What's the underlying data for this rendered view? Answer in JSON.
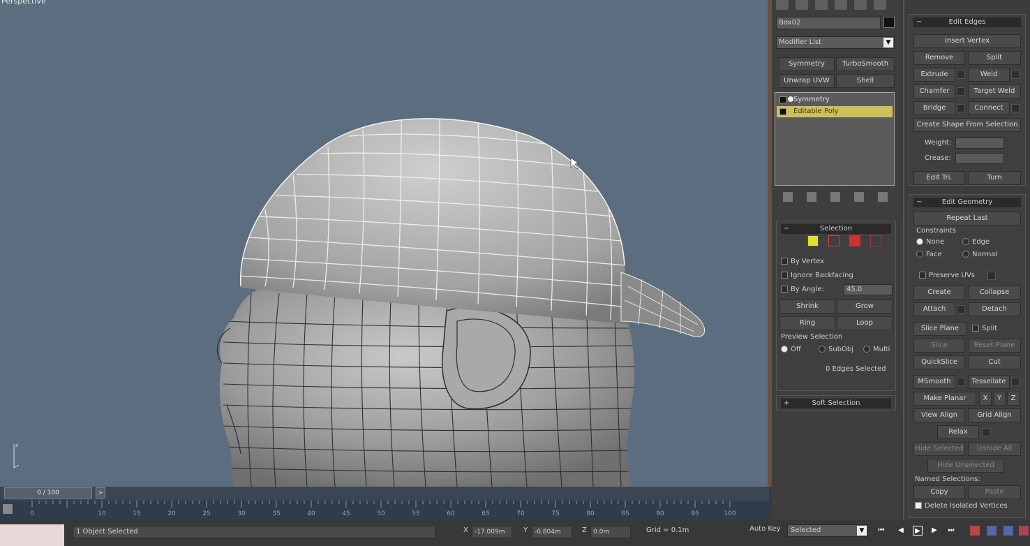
{
  "viewport": {
    "label": "Perspective"
  },
  "panel": {
    "object_name": "Box02",
    "modifier_list": "Modifier List",
    "quick_buttons": [
      "Symmetry",
      "TurboSmooth",
      "Unwrap UVW",
      "Shell"
    ],
    "stack": [
      {
        "name": "Symmetry",
        "selected": false
      },
      {
        "name": "Editable Poly",
        "selected": true
      }
    ],
    "selection": {
      "title": "Selection",
      "by_vertex": "By Vertex",
      "ignore_backfacing": "Ignore Backfacing",
      "by_angle": "By Angle:",
      "angle_value": "45.0",
      "shrink": "Shrink",
      "grow": "Grow",
      "ring": "Ring",
      "loop": "Loop",
      "preview_label": "Preview Selection",
      "preview_options": [
        "Off",
        "SubObj",
        "Multi"
      ],
      "status": "0 Edges Selected"
    },
    "soft_selection": {
      "title": "Soft Selection"
    },
    "edit_edges": {
      "title": "Edit Edges",
      "insert_vertex": "Insert Vertex",
      "remove": "Remove",
      "split": "Split",
      "extrude": "Extrude",
      "weld": "Weld",
      "chamfer": "Chamfer",
      "target_weld": "Target Weld",
      "bridge": "Bridge",
      "connect": "Connect",
      "create_shape": "Create Shape From Selection",
      "weight": "Weight:",
      "crease": "Crease:",
      "edit_tri": "Edit Tri.",
      "turn": "Turn"
    },
    "edit_geometry": {
      "title": "Edit Geometry",
      "repeat_last": "Repeat Last",
      "constraints": "Constraints",
      "constraint_none": "None",
      "constraint_edge": "Edge",
      "constraint_face": "Face",
      "constraint_normal": "Normal",
      "preserve_uvs": "Preserve UVs",
      "create": "Create",
      "collapse": "Collapse",
      "attach": "Attach",
      "detach": "Detach",
      "slice_plane": "Slice Plane",
      "split": "Split",
      "slice": "Slice",
      "reset_plane": "Reset Plane",
      "quickslice": "QuickSlice",
      "cut": "Cut",
      "msmooth": "MSmooth",
      "tessellate": "Tessellate",
      "make_planar": "Make Planar",
      "x": "X",
      "y": "Y",
      "z": "Z",
      "view_align": "View Align",
      "grid_align": "Grid Align",
      "relax": "Relax",
      "hide_selected": "Hide Selected",
      "unhide_all": "Unhide All",
      "hide_unselected": "Hide Unselected",
      "named_selections": "Named Selections:",
      "copy": "Copy",
      "paste": "Paste",
      "delete_isolated": "Delete Isolated Vertices"
    }
  },
  "timeline": {
    "slider": "0 / 100",
    "next": ">",
    "ticks": [
      "0",
      "10",
      "15",
      "20",
      "25",
      "30",
      "35",
      "40",
      "45",
      "50",
      "55",
      "60",
      "65",
      "70",
      "75",
      "80",
      "85",
      "90",
      "95",
      "100"
    ]
  },
  "status": {
    "selection": "1 Object Selected",
    "x_label": "X",
    "x_value": "-17.009m",
    "y_label": "Y",
    "y_value": "-0.804m",
    "z_label": "Z",
    "z_value": "0.0m",
    "grid": "Grid = 0.1m",
    "auto_key": "Auto Key",
    "auto_key_mode": "Selected"
  },
  "colors": {
    "viewport_bg": "#5d6d80",
    "selected_modifier": "#cfc05a",
    "panel_bg": "#3e3e3e"
  }
}
